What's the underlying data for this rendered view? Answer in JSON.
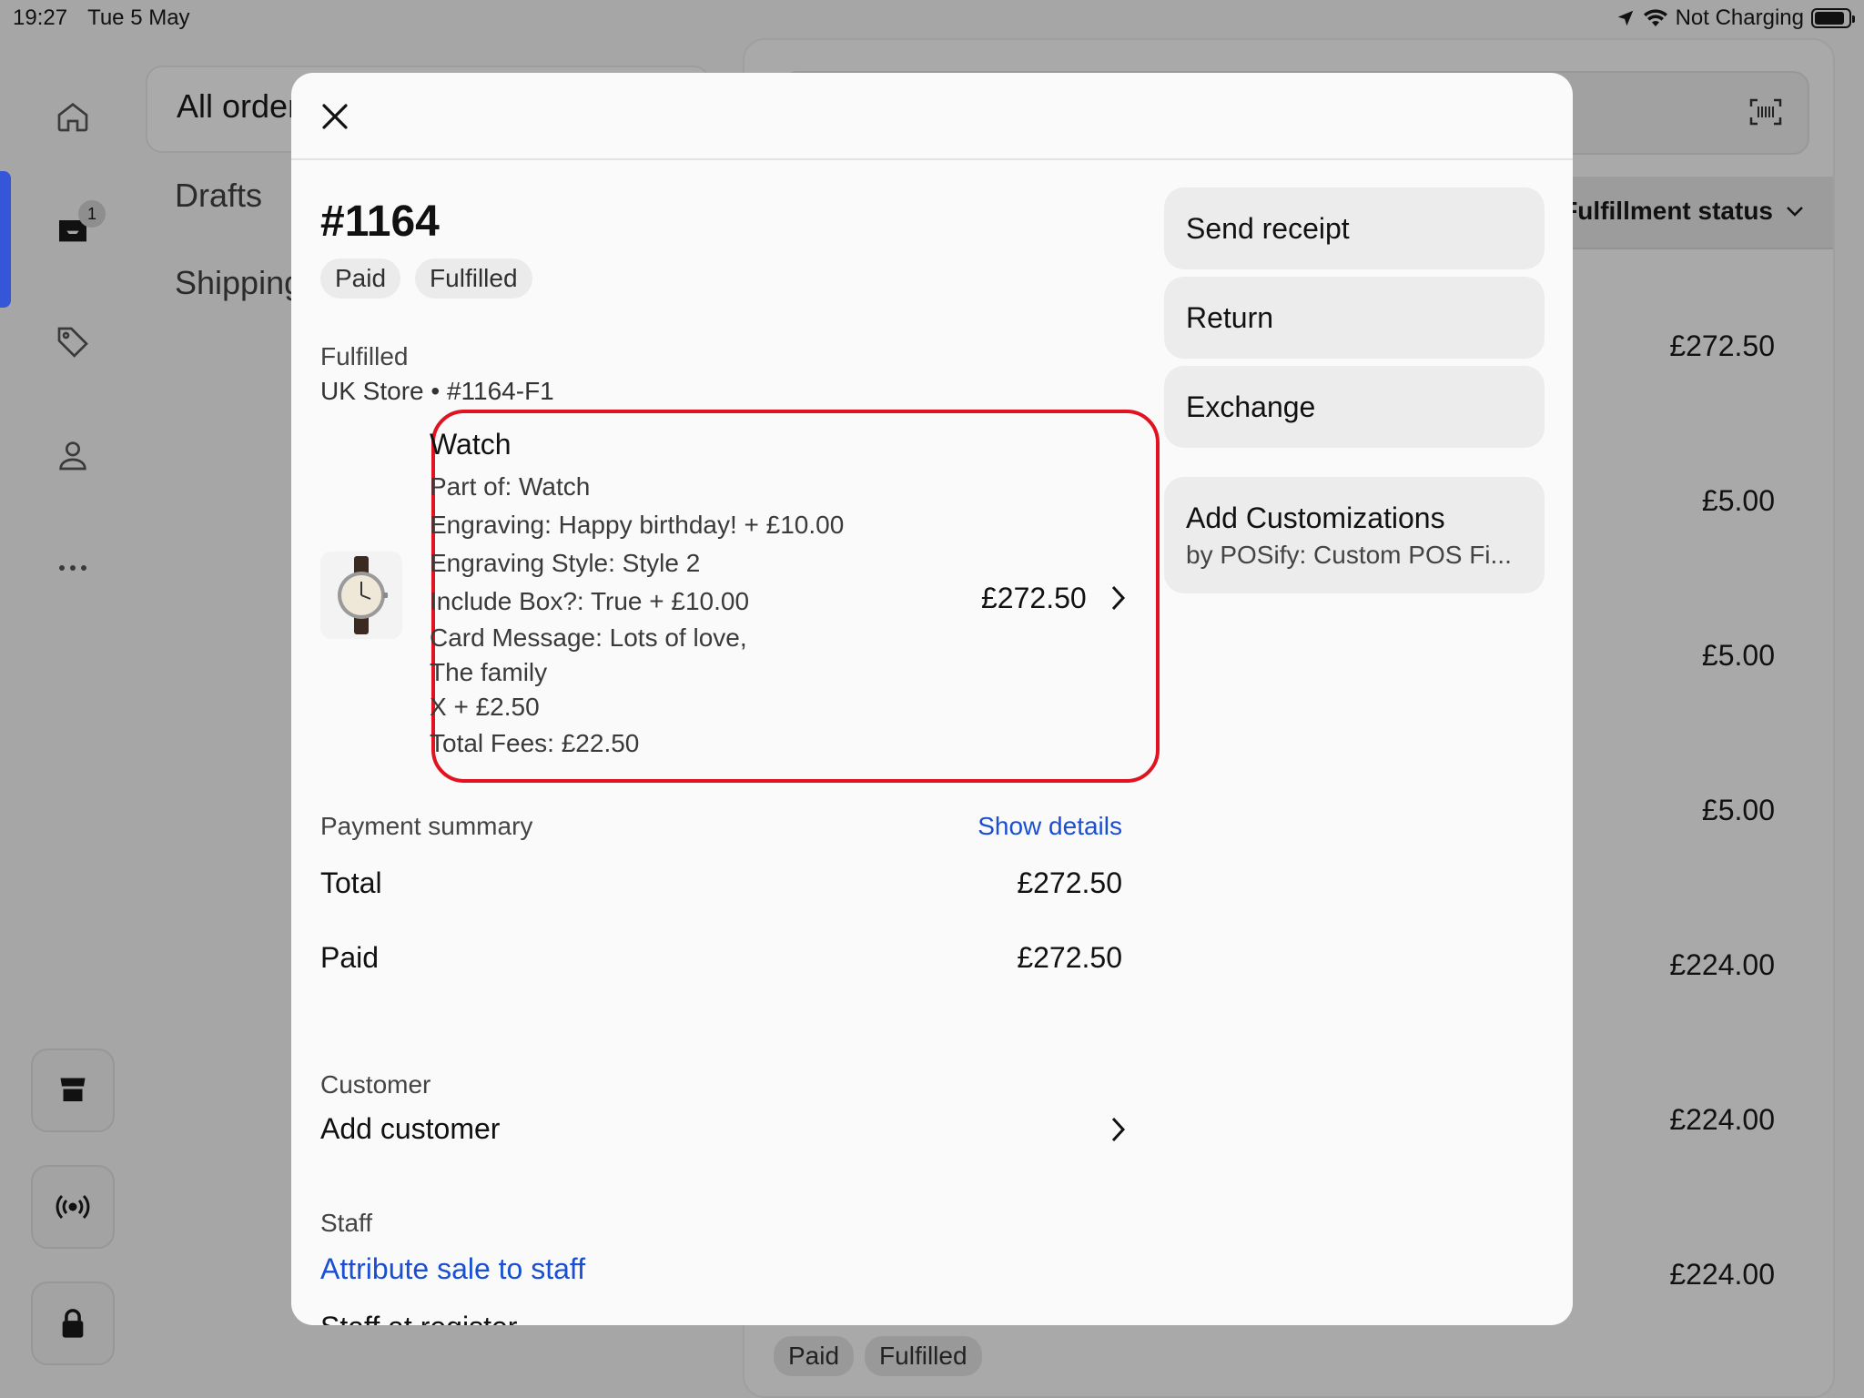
{
  "status_bar": {
    "time": "19:27",
    "date": "Tue 5 May",
    "charging": "Not Charging"
  },
  "background": {
    "tab_label": "All orders",
    "nav_items": [
      "Drafts",
      "Shipping"
    ],
    "inbox_badge": "1",
    "column_header": "Fulfillment status",
    "amounts": [
      "£272.50",
      "£5.00",
      "£5.00",
      "£5.00",
      "£224.00",
      "£224.00",
      "£224.00"
    ],
    "row_pills": [
      "Paid",
      "Fulfilled"
    ]
  },
  "modal": {
    "order_number": "#1164",
    "status_pills": [
      "Paid",
      "Fulfilled"
    ],
    "fulfillment": {
      "label": "Fulfilled",
      "location": "UK Store • #1164-F1"
    },
    "line_item": {
      "title": "Watch",
      "details": [
        "Part of: Watch",
        "Engraving: Happy birthday! + £10.00",
        "Engraving Style: Style 2",
        "Include Box?: True + £10.00",
        "Card Message: Lots of love,",
        "The family",
        "X + £2.50",
        "Total Fees: £22.50"
      ],
      "price": "£272.50"
    },
    "payment": {
      "label": "Payment summary",
      "show_details": "Show details",
      "total_label": "Total",
      "total_value": "£272.50",
      "paid_label": "Paid",
      "paid_value": "£272.50"
    },
    "customer": {
      "label": "Customer",
      "action": "Add customer"
    },
    "staff": {
      "label": "Staff",
      "action": "Attribute sale to staff",
      "register_label": "Staff at register"
    },
    "actions": {
      "send_receipt": "Send receipt",
      "return": "Return",
      "exchange": "Exchange",
      "customizations_title": "Add Customizations",
      "customizations_sub": "by POSify: Custom POS Fi..."
    }
  }
}
